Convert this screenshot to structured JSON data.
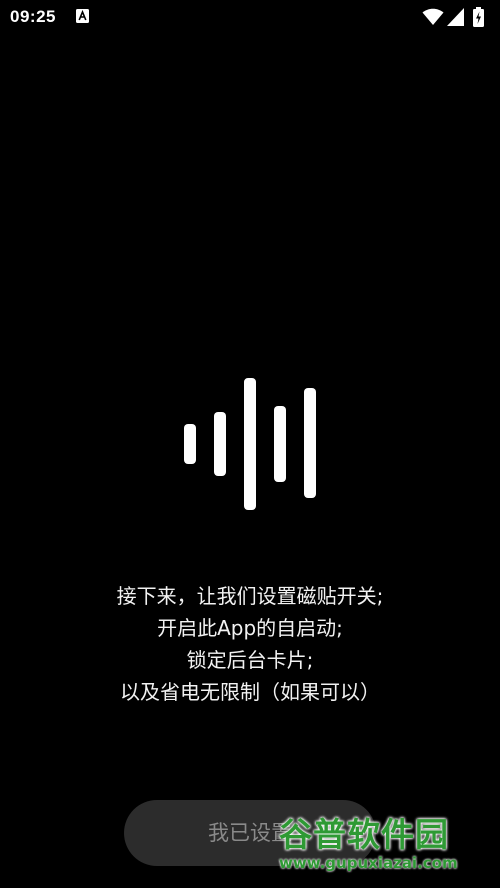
{
  "status_bar": {
    "time": "09:25",
    "icons": [
      "notification-a-icon",
      "wifi-icon",
      "signal-icon",
      "battery-charging-icon"
    ]
  },
  "logo": {
    "icon": "sound-wave-icon",
    "color": "#ffffff"
  },
  "message": {
    "lines": [
      "接下来，让我们设置磁贴开关;",
      "开启此App的自启动;",
      "锁定后台卡片;",
      "以及省电无限制（如果可以）"
    ]
  },
  "confirm_button": {
    "label": "我已设置"
  },
  "watermark": {
    "title": "谷普软件园",
    "url": "www.gupuxiazai.com",
    "color": "#2e9a34"
  },
  "colors": {
    "background": "#000000",
    "button_bg": "#2c2c2c",
    "button_text": "#8a8a8a"
  }
}
